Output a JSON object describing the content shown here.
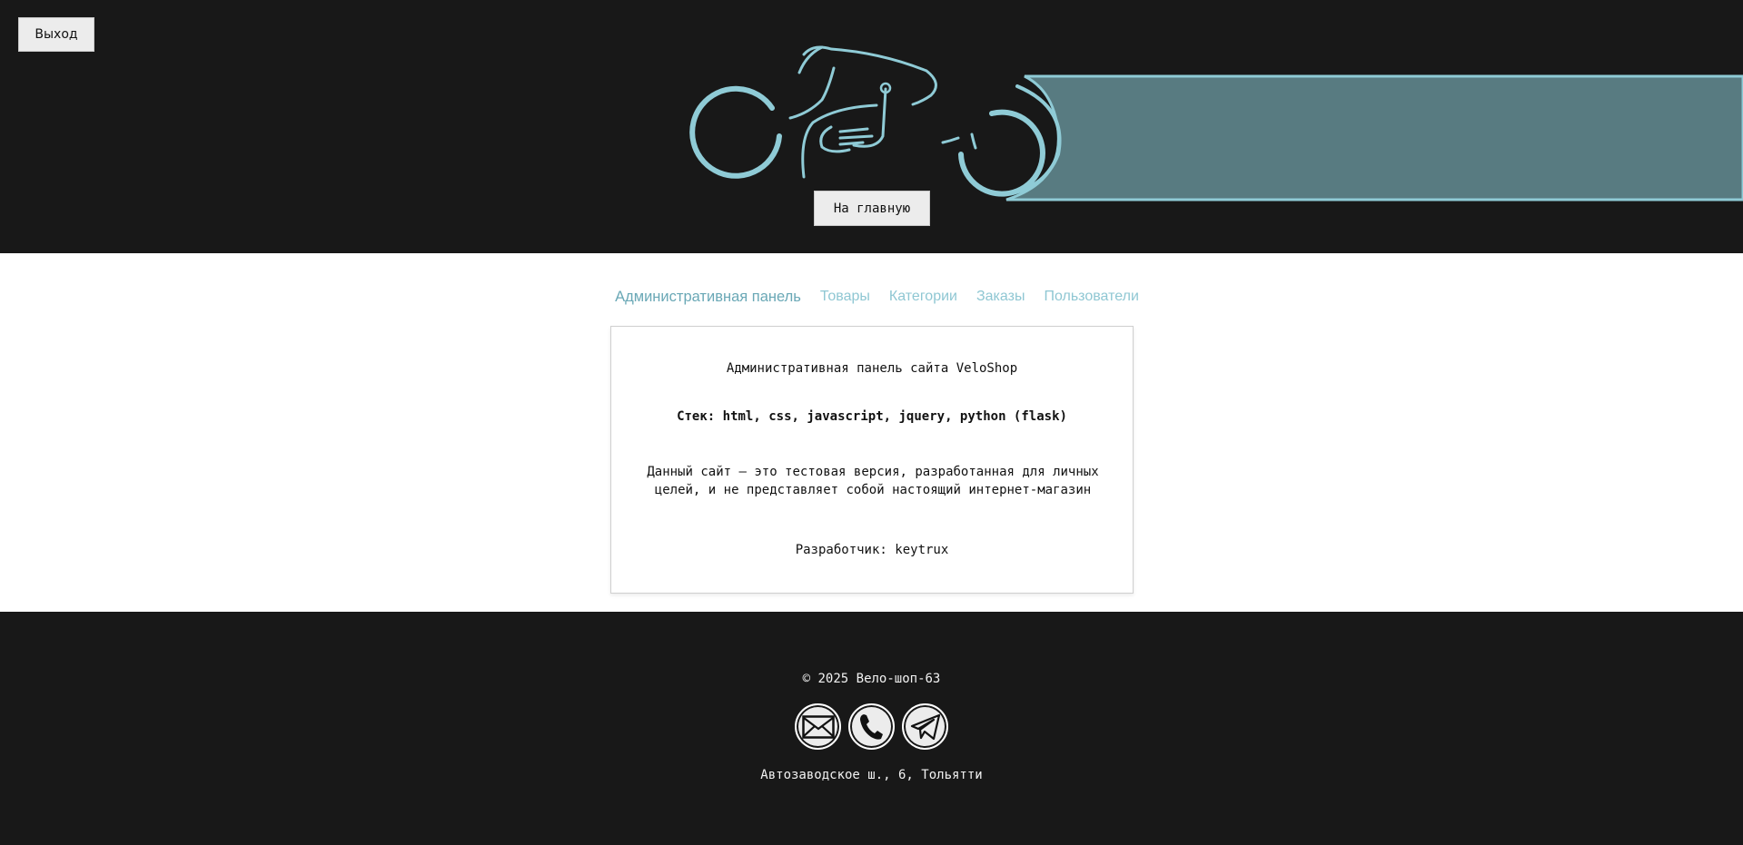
{
  "header": {
    "logout_label": "Выход",
    "home_label": "На главную",
    "logo_icon": "motorcycle-logo-icon",
    "accent_color": "#8fcbd6",
    "banner_color": "#587b81"
  },
  "nav": {
    "items": [
      {
        "label": "Административная панель",
        "active": true
      },
      {
        "label": "Товары"
      },
      {
        "label": "Категории"
      },
      {
        "label": "Заказы"
      },
      {
        "label": "Пользователи"
      }
    ]
  },
  "card": {
    "title": "Административная панель сайта VeloShop",
    "stack": "Стек: html, css, javascript, jquery, python (flask)",
    "description": "Данный сайт — это тестовая версия, разработанная для личных целей, и не представляет собой настоящий интернет-магазин",
    "developer": "Разработчик: keytrux"
  },
  "footer": {
    "copyright": "© 2025 Вело-шоп-63",
    "socials": [
      {
        "icon": "email-icon"
      },
      {
        "icon": "phone-icon"
      },
      {
        "icon": "telegram-icon"
      }
    ],
    "address": "Автозаводское ш., 6, Тольятти"
  }
}
